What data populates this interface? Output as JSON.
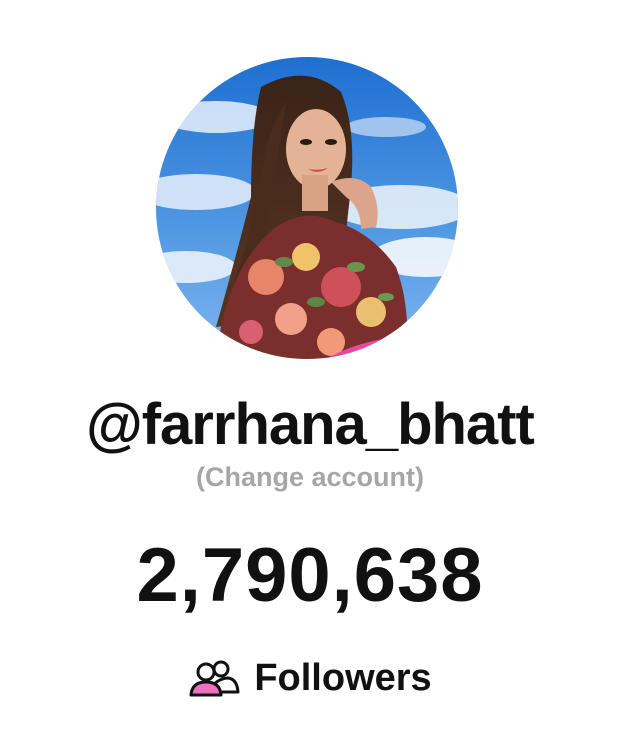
{
  "profile": {
    "username": "@farrhana_bhatt",
    "change_account_label": "(Change account)",
    "follower_count": "2,790,638",
    "followers_label": "Followers",
    "followers_icon": "people-icon",
    "accent_color": "#f06fbf"
  }
}
